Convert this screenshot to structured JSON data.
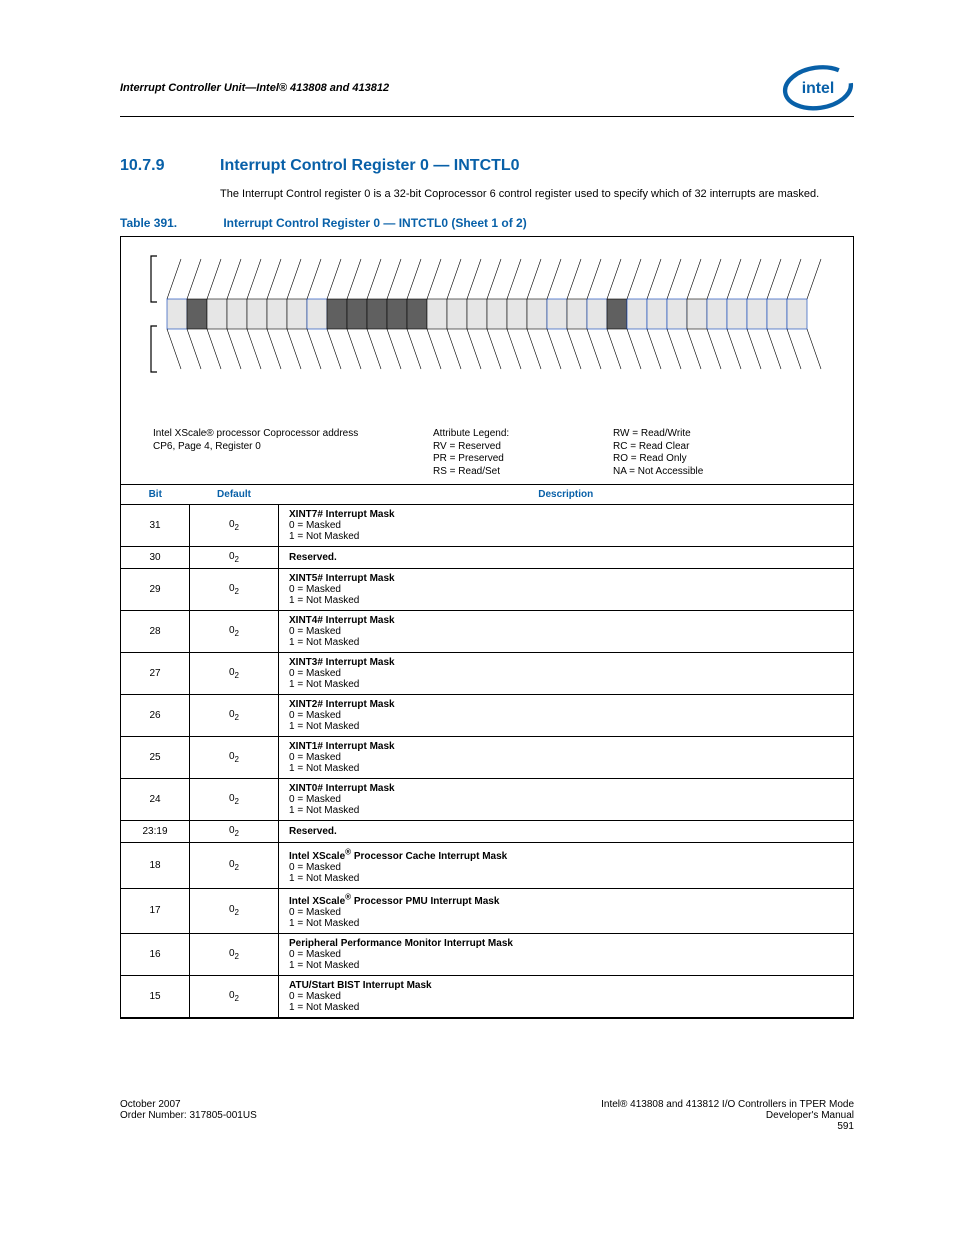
{
  "header": {
    "title": "Interrupt Controller Unit—Intel® 413808 and 413812",
    "logo_alt": "Intel"
  },
  "section": {
    "number": "10.7.9",
    "title": "Interrupt Control Register 0 — INTCTL0",
    "intro": "The Interrupt Control register 0 is a 32-bit Coprocessor 6 control register used to specify which of 32 interrupts are masked."
  },
  "table_caption": {
    "label": "Table 391.",
    "text": "Interrupt Control Register 0 — INTCTL0 (Sheet 1 of 2)"
  },
  "diagram": {
    "address_line1": "Intel XScale® processor Coprocessor address",
    "address_line2": "CP6, Page 4, Register 0",
    "legend_title": "Attribute Legend:",
    "legend_rv": "RV = Reserved",
    "legend_pr": "PR = Preserved",
    "legend_rs": "RS = Read/Set",
    "legend_rw": "RW = Read/Write",
    "legend_rc": "RC = Read Clear",
    "legend_ro": "RO = Read Only",
    "legend_na": "NA = Not Accessible"
  },
  "columns": {
    "bit": "Bit",
    "default": "Default",
    "description": "Description"
  },
  "rows": [
    {
      "bit": "31",
      "default": "0",
      "desc_title": "XINT7# Interrupt Mask",
      "desc_line1": "0 = Masked",
      "desc_line2": "1 = Not Masked"
    },
    {
      "bit": "30",
      "default": "0",
      "desc_title": "Reserved.",
      "desc_line1": "",
      "desc_line2": ""
    },
    {
      "bit": "29",
      "default": "0",
      "desc_title": "XINT5# Interrupt Mask",
      "desc_line1": "0 = Masked",
      "desc_line2": "1 = Not Masked"
    },
    {
      "bit": "28",
      "default": "0",
      "desc_title": "XINT4# Interrupt Mask",
      "desc_line1": "0 = Masked",
      "desc_line2": "1 = Not Masked"
    },
    {
      "bit": "27",
      "default": "0",
      "desc_title": "XINT3# Interrupt Mask",
      "desc_line1": "0 = Masked",
      "desc_line2": "1 = Not Masked"
    },
    {
      "bit": "26",
      "default": "0",
      "desc_title": "XINT2# Interrupt Mask",
      "desc_line1": "0 = Masked",
      "desc_line2": "1 = Not Masked"
    },
    {
      "bit": "25",
      "default": "0",
      "desc_title": "XINT1# Interrupt Mask",
      "desc_line1": "0 = Masked",
      "desc_line2": "1 = Not Masked"
    },
    {
      "bit": "24",
      "default": "0",
      "desc_title": "XINT0# Interrupt Mask",
      "desc_line1": "0 = Masked",
      "desc_line2": "1 = Not Masked"
    },
    {
      "bit": "23:19",
      "default": "0",
      "desc_title": "Reserved.",
      "desc_line1": "",
      "desc_line2": ""
    },
    {
      "bit": "18",
      "default": "0",
      "desc_title": "Intel XScale® Processor Cache Interrupt Mask",
      "desc_line1": "0 = Masked",
      "desc_line2": "1 = Not Masked"
    },
    {
      "bit": "17",
      "default": "0",
      "desc_title": "Intel XScale® Processor PMU Interrupt Mask",
      "desc_line1": "0 = Masked",
      "desc_line2": "1 = Not Masked"
    },
    {
      "bit": "16",
      "default": "0",
      "desc_title": "Peripheral Performance Monitor Interrupt Mask",
      "desc_line1": "0 = Masked",
      "desc_line2": "1 = Not Masked"
    },
    {
      "bit": "15",
      "default": "0",
      "desc_title": "ATU/Start BIST Interrupt Mask",
      "desc_line1": "0 = Masked",
      "desc_line2": "1 = Not Masked"
    }
  ],
  "bit_styles": {
    "dark": [
      30,
      23,
      22,
      21,
      20,
      19,
      9
    ],
    "blue": [
      31,
      24,
      7,
      12,
      10,
      8,
      6,
      4,
      3,
      2,
      1,
      0
    ]
  },
  "footer": {
    "left_line1": "October 2007",
    "left_line2": "Order Number: 317805-001US",
    "right_line1": "Intel® 413808 and 413812 I/O Controllers in TPER Mode",
    "right_line2": "Developer's Manual",
    "right_line3": "591"
  }
}
